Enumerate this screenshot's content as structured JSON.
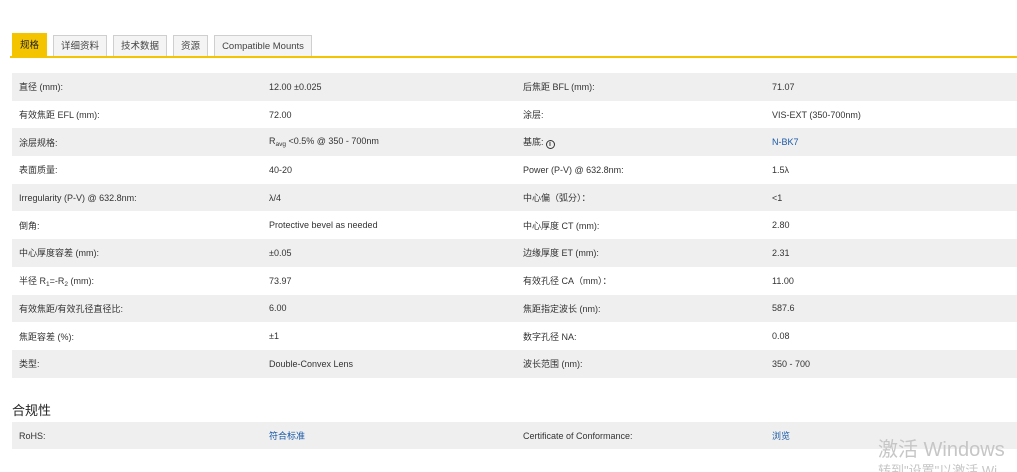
{
  "tabs": [
    {
      "label": "规格",
      "active": true
    },
    {
      "label": "详细资料"
    },
    {
      "label": "技术数据"
    },
    {
      "label": "资源"
    },
    {
      "label": "Compatible Mounts"
    }
  ],
  "specs": [
    {
      "l1": "直径 (mm):",
      "v1": "12.00 ±0.025",
      "l2": "后焦距 BFL (mm):",
      "v2": "71.07"
    },
    {
      "l1": "有效焦距 EFL (mm):",
      "v1": "72.00",
      "l2": "涂层:",
      "v2": "VIS-EXT (350-700nm)"
    },
    {
      "l1": "涂层规格:",
      "v1_pre": "R",
      "v1_sub": "avg",
      "v1_post": " <0.5% @ 350 - 700nm",
      "l2": "基底:",
      "v2": "N-BK7"
    },
    {
      "l1": "表面质量:",
      "v1": "40-20",
      "l2": "Power (P-V) @ 632.8nm:",
      "v2": "1.5λ"
    },
    {
      "l1": "Irregularity (P-V) @ 632.8nm:",
      "v1": "λ/4",
      "l2": "中心偏（弧分）：",
      "v2": "<1"
    },
    {
      "l1": "倒角:",
      "v1": "Protective bevel as needed",
      "l2": "中心厚度 CT (mm):",
      "v2": "2.80"
    },
    {
      "l1": "中心厚度容差 (mm):",
      "v1": "±0.05",
      "l2": "边缘厚度 ET (mm):",
      "v2": "2.31"
    },
    {
      "l1_pre": "半径 R",
      "l1_sub1": "1",
      "l1_mid": "=-R",
      "l1_sub2": "2",
      "l1_post": " (mm):",
      "v1": "73.97",
      "l2": "有效孔径 CA（mm）：",
      "v2": "11.00"
    },
    {
      "l1": "有效焦距/有效孔径直径比:",
      "v1": "6.00",
      "l2": "焦距指定波长 (nm):",
      "v2": "587.6"
    },
    {
      "l1": "焦距容差 (%):",
      "v1": "±1",
      "l2": "数字孔径 NA:",
      "v2": "0.08"
    },
    {
      "l1": "类型:",
      "v1": "Double-Convex Lens",
      "l2": "波长范围 (nm):",
      "v2": "350 - 700"
    }
  ],
  "compliance": {
    "title": "合规性",
    "rohs_label": "RoHS:",
    "rohs_value": "符合标准",
    "cert_label": "Certificate of Conformance:",
    "cert_value": "浏览"
  },
  "watermark": {
    "line1": "激活 Windows",
    "line2": "转到\"设置\"以激活 Wi"
  },
  "colors": {
    "accent": "#f4c400",
    "link": "#1a5aa8",
    "row_alt": "#efefef"
  }
}
